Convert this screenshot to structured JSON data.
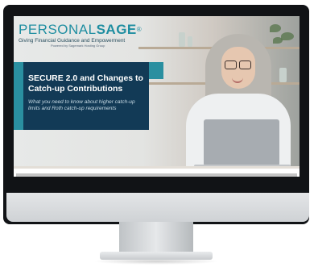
{
  "brand": {
    "personal": "PERSONAL",
    "sage": "SAGE",
    "registered": "®",
    "tagline": "Giving Financial Guidance and Empowerment",
    "powered_by": "Powered by Sagemark Hosting Group"
  },
  "slide": {
    "title": "SECURE 2.0 and Changes to Catch-up Contributions",
    "subtitle": "What you need to know about higher catch-up limits and Roth catch-up requirements"
  },
  "colors": {
    "brand_teal": "#1f8ea1",
    "title_navy": "#123a56",
    "bezel": "#111316"
  }
}
